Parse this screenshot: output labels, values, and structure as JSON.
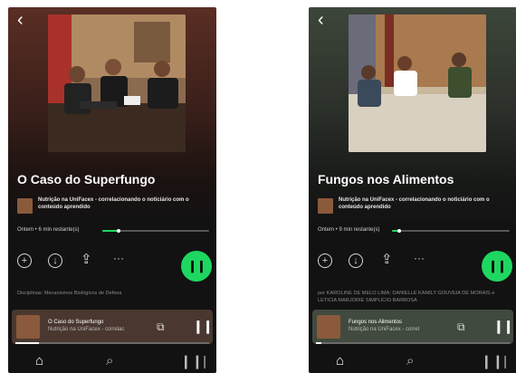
{
  "screens": [
    {
      "title": "O Caso do Superfungo",
      "show_name": "Nutrição na UniFacex - correlacionando o noticiário com o conteúdo aprendido",
      "meta": "Ontem • 6 min restante(s)",
      "progress": 0.15,
      "description": "Disciplinas: Mecanismos Biológicos de Defesa",
      "mini_player": {
        "title": "O Caso do Superfungo",
        "subtitle": "Nutrição na UniFacex - correlac",
        "progress": 0.12
      }
    },
    {
      "title": "Fungos nos Alimentos",
      "show_name": "Nutrição na UniFacex - correlacionando o noticiário com o conteúdo aprendido",
      "meta": "Ontem • 9 min restante(s)",
      "progress": 0.06,
      "description": "por KAROLINE DE MELO LIMA; DANIELLE KAMILY GOUVEIA DE MORAIS e LETICIA MARJORIE SIMPLICIO BARBOSA",
      "mini_player": {
        "title": "Fungos nos Alimentos",
        "subtitle": "Nutrição na UniFacex - correl",
        "progress": 0.03
      }
    }
  ],
  "icons": {
    "back": "chevron-left-icon",
    "add": "plus-circle-icon",
    "download": "download-circle-icon",
    "share": "share-icon",
    "more": "more-icon",
    "play_pause": "pause-icon",
    "devices": "devices-icon",
    "home": "home-icon",
    "search": "search-icon",
    "library": "library-icon"
  },
  "colors": {
    "accent": "#1ed760",
    "background": "#121212"
  }
}
